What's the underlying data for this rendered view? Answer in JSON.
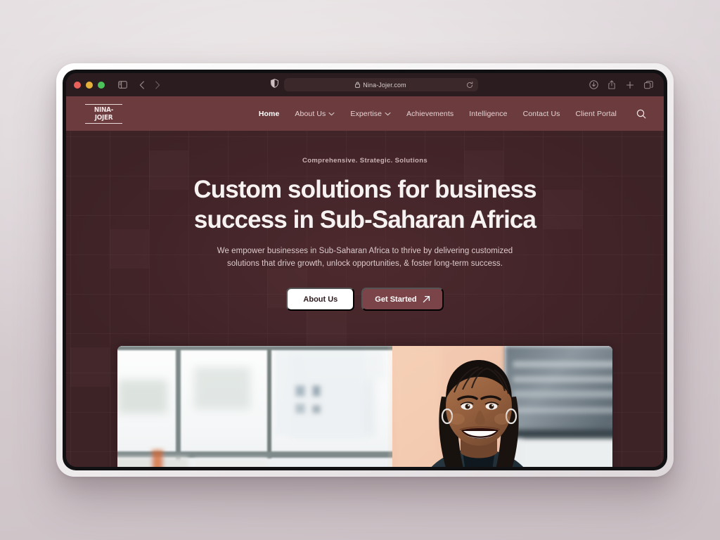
{
  "browser": {
    "url": "Nina-Jojer.com",
    "lock_icon": "lock-icon",
    "reload_icon": "reload-icon",
    "shield_icon": "shield-privacy-icon",
    "sidebar_icon": "sidebar-toggle-icon",
    "back_icon": "back-arrow-icon",
    "forward_icon": "forward-arrow-icon",
    "download_icon": "download-icon",
    "share_icon": "share-icon",
    "newtab_icon": "plus-new-tab-icon",
    "tabs_icon": "tab-overview-icon",
    "traffic_lights": [
      "close-red",
      "minimize-yellow",
      "maximize-green"
    ]
  },
  "site": {
    "logo_text": "NINA-JOJER",
    "nav": [
      {
        "label": "Home",
        "active": true,
        "dropdown": false
      },
      {
        "label": "About Us",
        "active": false,
        "dropdown": true
      },
      {
        "label": "Expertise",
        "active": false,
        "dropdown": true
      },
      {
        "label": "Achievements",
        "active": false,
        "dropdown": false
      },
      {
        "label": "Intelligence",
        "active": false,
        "dropdown": false
      },
      {
        "label": "Contact Us",
        "active": false,
        "dropdown": false
      },
      {
        "label": "Client Portal",
        "active": false,
        "dropdown": false
      }
    ],
    "search_icon": "search-icon"
  },
  "hero": {
    "eyebrow": "Comprehensive. Strategic. Solutions",
    "headline_line1": "Custom solutions for business",
    "headline_line2": "success in Sub-Saharan Africa",
    "subhead_line1": "We empower businesses in Sub-Saharan Africa to thrive by delivering customized",
    "subhead_line2": "solutions that drive growth, unlock opportunities, & foster long-term success.",
    "cta_primary": "About Us",
    "cta_secondary": "Get Started",
    "cta_secondary_icon": "arrow-up-right-icon",
    "photo_alt": "Smiling businesswoman in dark blazer in a bright modern office with city-view windows"
  },
  "colors": {
    "nav_bar": "#6b3b3e",
    "hero_bg": "#3d2226",
    "chrome_bg": "#2b1c1f",
    "cta_secondary_bg": "#7b4448",
    "page_bg": "#e2dbdd"
  }
}
